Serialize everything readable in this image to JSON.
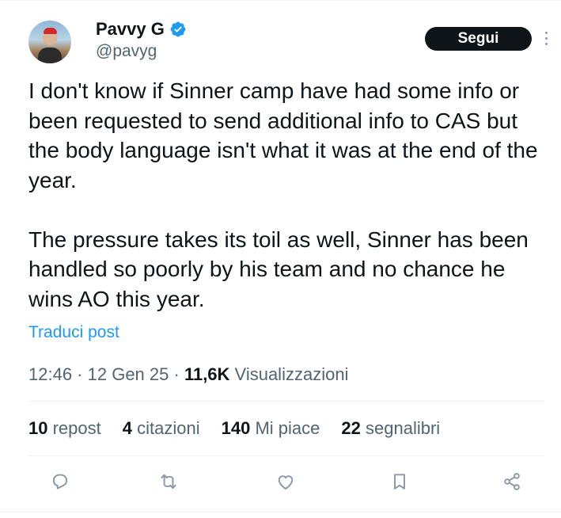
{
  "user": {
    "display_name": "Pavvy G",
    "handle": "@pavyg",
    "verified": true
  },
  "follow_button": {
    "label": "Segui"
  },
  "tweet": {
    "paragraphs": [
      "I don't know if Sinner camp have had some info or been requested to send additional info to CAS but the body language isn't what it was at the end of the year.",
      "The pressure takes its toil as well, Sinner has been handled so poorly by his team and no chance he wins AO this year."
    ]
  },
  "translate_link": "Traduci post",
  "meta": {
    "time": "12:46",
    "sep1": " · ",
    "date": "12 Gen 25",
    "sep2": " · ",
    "views_count": "11,6K",
    "views_label": " Visualizzazioni"
  },
  "stats": [
    {
      "count": "10",
      "label": "repost"
    },
    {
      "count": "4",
      "label": "citazioni"
    },
    {
      "count": "140",
      "label": "Mi piace"
    },
    {
      "count": "22",
      "label": "segnalibri"
    }
  ],
  "actions": [
    {
      "icon": "reply-icon"
    },
    {
      "icon": "repost-icon"
    },
    {
      "icon": "like-icon"
    },
    {
      "icon": "bookmark-icon"
    },
    {
      "icon": "share-icon"
    }
  ],
  "colors": {
    "text": "#0f1419",
    "secondary": "#536471",
    "link": "#1d9bf0",
    "verified": "#1d9bf0",
    "icon": "#8b98a5"
  }
}
